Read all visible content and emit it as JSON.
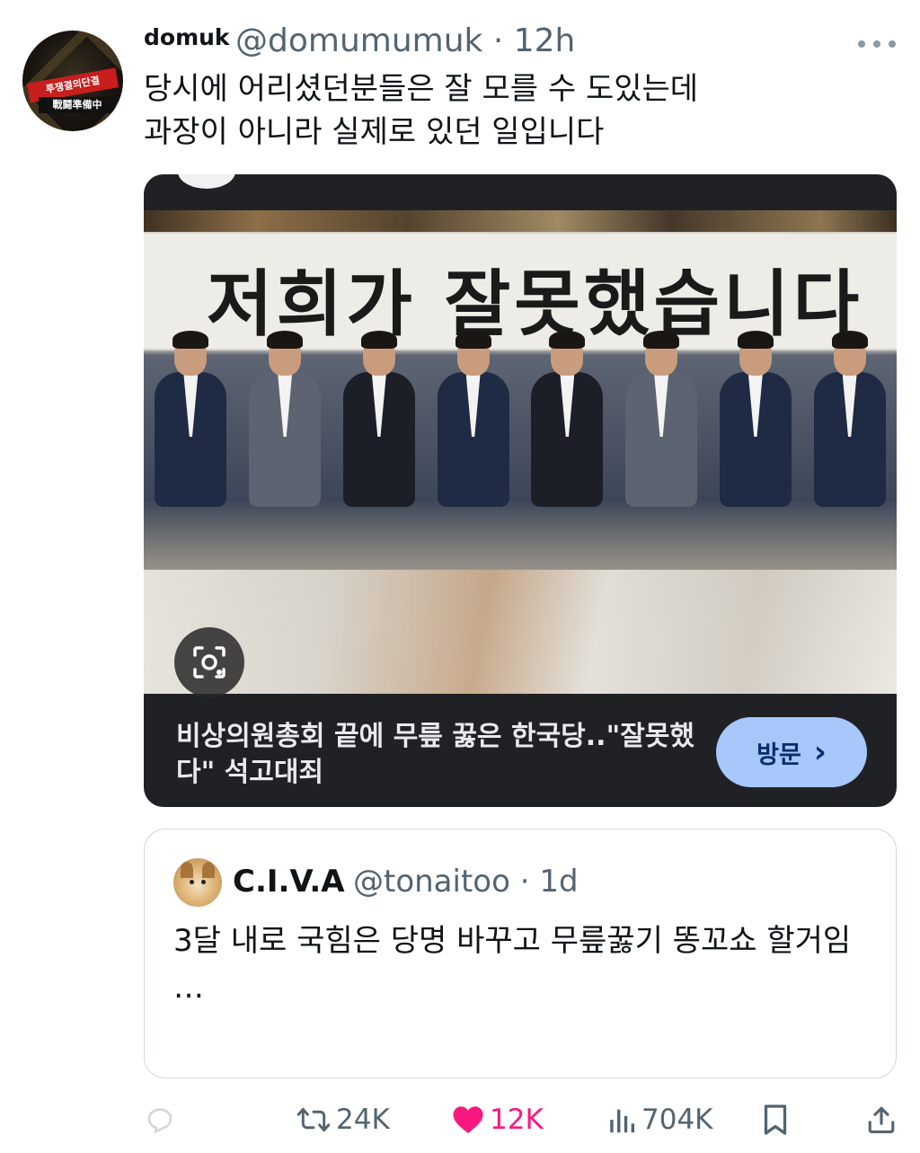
{
  "tweet": {
    "display_name": "domuk",
    "handle_time": "@domumumuk · 12h",
    "text_line1": "당시에 어리셨던분들은 잘 모를 수 도있는데",
    "text_line2": "과장이 아니라 실제로 있던 일입니다",
    "avatar_band_text": "투쟁결의단결",
    "avatar_band2_text": "戰鬪準備中"
  },
  "card": {
    "banner_text": "저희가 잘못했습니다",
    "title": "비상의원총회 끝에 무릎 꿇은 한국당..\"잘못했다\" 석고대죄",
    "visit_label": "방문",
    "visit_chevron": "›"
  },
  "quote": {
    "display_name": "C.I.V.A",
    "handle_time": "@tonaitoo · 1d",
    "text": "3달 내로 국힘은 당명 바꾸고 무릎꿇기 똥꼬쇼 할거임",
    "ellipsis": "…"
  },
  "actions": {
    "replies": "",
    "retweets": "24K",
    "likes": "12K",
    "views": "704K"
  },
  "colors": {
    "like": "#f91880",
    "muted": "#536471",
    "visit_button": "#a8c7fa"
  }
}
